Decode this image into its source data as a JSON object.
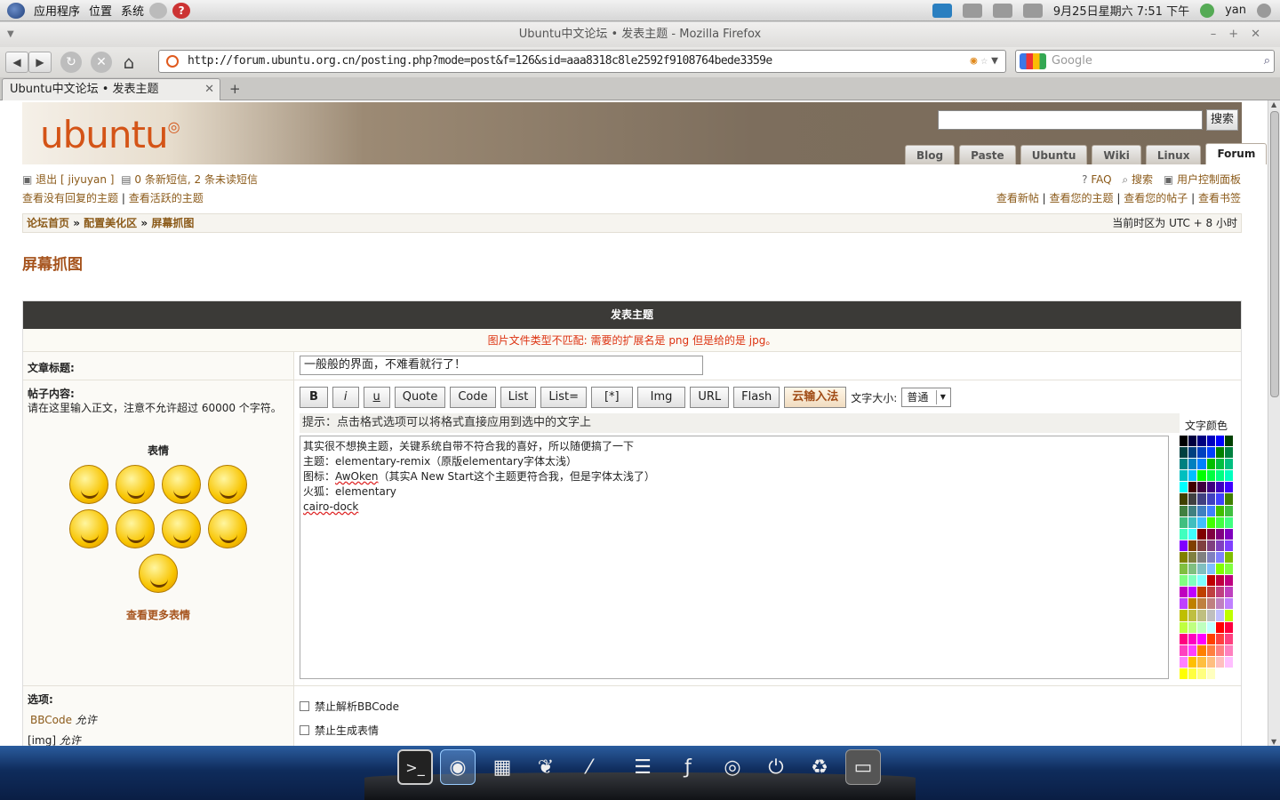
{
  "panel": {
    "menus": [
      "应用程序",
      "位置",
      "系统"
    ],
    "datetime": "9月25日星期六 7:51 下午",
    "user": "yan"
  },
  "window": {
    "title": "Ubuntu中文论坛 • 发表主题 - Mozilla Firefox"
  },
  "browser": {
    "url": "http://forum.ubuntu.org.cn/posting.php?mode=post&f=126&sid=aaa8318c8le2592f9108764bede3359e",
    "search_placeholder": "Google",
    "tab_title": "Ubuntu中文论坛 • 发表主题",
    "new_tab": "+"
  },
  "header": {
    "brand": "ubuntu",
    "search_button": "搜索",
    "tabs": [
      "Blog",
      "Paste",
      "Ubuntu",
      "Wiki",
      "Linux",
      "Forum"
    ],
    "active_tab": "Forum"
  },
  "userbar": {
    "logout": "退出 [ jiyuyan ]",
    "messages": "0 条新短信, 2 条未读短信",
    "faq": "FAQ",
    "search": "搜索",
    "ucp": "用户控制面板"
  },
  "links": {
    "unanswered": "查看没有回复的主题",
    "active": "查看活跃的主题",
    "sep": "|",
    "new_posts": "查看新帖",
    "your_topics": "查看您的主题",
    "your_posts": "查看您的帖子",
    "bookmarks": "查看书签"
  },
  "breadcrumb": {
    "items": [
      "论坛首页",
      "配置美化区",
      "屏幕抓图"
    ],
    "sep": "»",
    "timezone": "当前时区为 UTC + 8 小时"
  },
  "page_title": "屏幕抓图",
  "form": {
    "heading": "发表主题",
    "error": "图片文件类型不匹配: 需要的扩展名是 png 但是给的是 jpg。",
    "subject_label": "文章标题:",
    "subject_value": "一般般的界面，不难看就行了！",
    "body_label": "帖子内容:",
    "body_help": "请在这里输入正文，注意不允许超过 60000 个字符。",
    "smilies_title": "表情",
    "more_smilies": "查看更多表情",
    "toolbar": [
      "B",
      "i",
      "u",
      "Quote",
      "Code",
      "List",
      "List=",
      "[*]",
      "Img",
      "URL",
      "Flash",
      "云输入法"
    ],
    "font_size_label": "文字大小:",
    "font_size_value": "普通",
    "hint": "提示：点击格式选项可以将格式直接应用到选中的文字上",
    "color_label": "文字颜色",
    "body_lines": [
      "其实很不想换主题，关键系统自带不符合我的喜好，所以随便搞了一下",
      "主题：elementary-remix（原版elementary字体太浅）",
      "图标：",
      "AwOken",
      "（其实A New Start这个主题更符合我，但是字体太浅了）",
      "火狐：elementary",
      "cairo-dock"
    ],
    "options_label": "选项:",
    "bbcode": "BBCode",
    "bbcode_state": "允许",
    "img": "[img]",
    "img_state": "允许",
    "opt_disable_bbcode": "禁止解析BBCode",
    "opt_disable_smilies": "禁止生成表情"
  }
}
